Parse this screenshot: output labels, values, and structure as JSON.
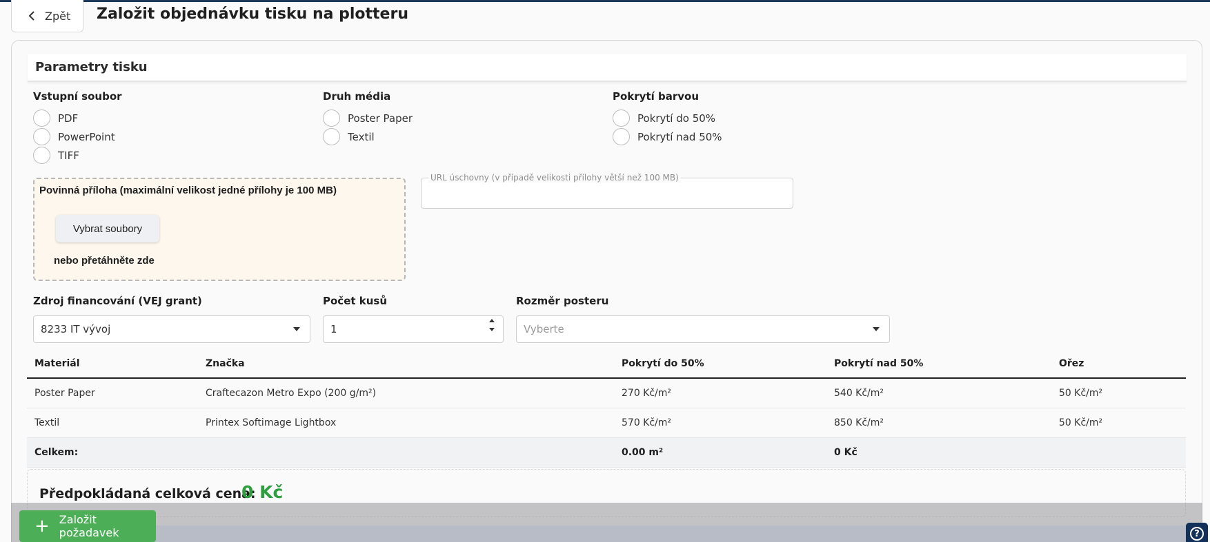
{
  "header": {
    "back_label": "Zpět",
    "title": "Založit objednávku tisku na plotteru"
  },
  "section": {
    "title": "Parametry tisku"
  },
  "input_file": {
    "label": "Vstupní soubor",
    "options": [
      "PDF",
      "PowerPoint",
      "TIFF"
    ]
  },
  "media_type": {
    "label": "Druh média",
    "options": [
      "Poster Paper",
      "Textil"
    ]
  },
  "color_coverage": {
    "label": "Pokrytí barvou",
    "options": [
      "Pokrytí do 50%",
      "Pokrytí nad 50%"
    ]
  },
  "attachment": {
    "title": "Povinná příloha (maximální velikost jedné přílohy je 100 MB)",
    "button_label": "Vybrat soubory",
    "drop_hint": "nebo přetáhněte zde"
  },
  "url_storage": {
    "label": "URL úschovny (v případě velikosti přílohy větší než 100 MB)",
    "value": ""
  },
  "funding": {
    "label": "Zdroj financování (VEJ grant)",
    "value": "8233 IT vývoj"
  },
  "quantity": {
    "label": "Počet kusů",
    "value": "1"
  },
  "poster_size": {
    "label": "Rozměr posteru",
    "placeholder": "Vyberte"
  },
  "table": {
    "headers": [
      "Materiál",
      "Značka",
      "Pokrytí do 50%",
      "Pokrytí nad 50%",
      "Ořez"
    ],
    "rows": [
      [
        "Poster Paper",
        "Craftecazon Metro Expo (200 g/m²)",
        "270 Kč/m²",
        "540 Kč/m²",
        "50 Kč/m²"
      ],
      [
        "Textil",
        "Printex Softimage Lightbox",
        "570 Kč/m²",
        "850 Kč/m²",
        "50 Kč/m²"
      ]
    ],
    "total": {
      "label": "Celkem:",
      "area": "0.00 m²",
      "price": "0 Kč"
    }
  },
  "estimate": {
    "label": "Předpokládaná celková cena:",
    "value": "0 Kč"
  },
  "actions": {
    "submit_label": "Založit požadavek",
    "help_icon": "help-icon"
  },
  "colors": {
    "accent_green": "#4caf57",
    "price_green": "#2e9e3e",
    "help_navy": "#12315a",
    "dropzone_bg": "#fdf7ee"
  }
}
